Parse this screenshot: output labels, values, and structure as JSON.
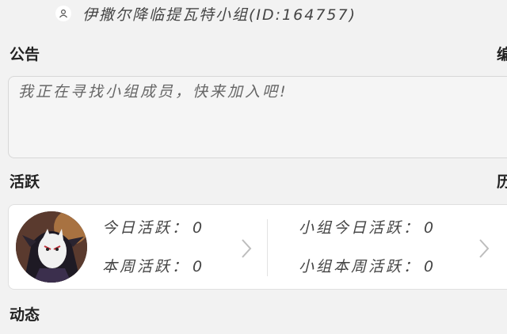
{
  "title_bar": {
    "group_name": "伊撒尔降临提瓦特小组(ID:164757)",
    "icon": "group-icon"
  },
  "notice": {
    "label": "公告",
    "edit_label": "编",
    "text": "我正在寻找小组成员，快来加入吧!"
  },
  "activity": {
    "label": "活跃",
    "history_label": "历",
    "avatar_icon": "avatar-image",
    "personal_today_label": "今日活跃：",
    "personal_today_value": "0",
    "personal_week_label": "本周活跃：",
    "personal_week_value": "0",
    "group_today_label": "小组今日活跃：",
    "group_today_value": "0",
    "group_week_label": "小组本周活跃：",
    "group_week_value": "0"
  },
  "dynamics": {
    "label": "动态"
  }
}
